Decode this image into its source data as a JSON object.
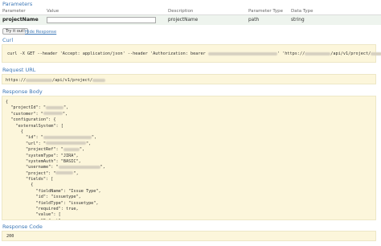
{
  "parameters": {
    "title": "Parameters",
    "headers": [
      "Parameter",
      "Value",
      "Description",
      "Parameter Type",
      "Data Type"
    ],
    "row": {
      "name": "projectName",
      "value": "",
      "description": "projectName",
      "param_type": "path",
      "data_type": "string"
    }
  },
  "actions": {
    "try_it": "Try it out!",
    "hide_response": "Hide Response"
  },
  "curl": {
    "title": "Curl",
    "part1": "curl -X GET --header 'Accept: application/json' --header 'Authorization: bearer ",
    "part2": "' 'https://",
    "part3": "/api/v1/project/",
    "part4": "'"
  },
  "request_url": {
    "title": "Request URL",
    "part1": "https://",
    "part2": "/api/v1/project/"
  },
  "response_body": {
    "title": "Response Body",
    "lines": [
      {
        "pre": "{",
        "post": ""
      },
      {
        "pre": "  \"projectId\": \"",
        "post": "\","
      },
      {
        "pre": "  \"customer\": \"",
        "post": "\","
      },
      {
        "pre": "  \"configuration\": {",
        "post": ""
      },
      {
        "pre": "    \"externalSystem\": [",
        "post": ""
      },
      {
        "pre": "      {",
        "post": ""
      },
      {
        "pre": "        \"id\": \"",
        "post": "\","
      },
      {
        "pre": "        \"url\": \"",
        "post": "\","
      },
      {
        "pre": "        \"projectRef\": \"",
        "post": "\","
      },
      {
        "pre": "        \"systemType\": \"JIRA\",",
        "post": ""
      },
      {
        "pre": "        \"systemAuth\": \"BASIC\",",
        "post": ""
      },
      {
        "pre": "        \"username\": \"",
        "post": "\","
      },
      {
        "pre": "        \"project\": \"",
        "post": "\","
      },
      {
        "pre": "        \"fields\": [",
        "post": ""
      },
      {
        "pre": "          {",
        "post": ""
      },
      {
        "pre": "            \"fieldName\": \"Issue Type\",",
        "post": ""
      },
      {
        "pre": "            \"id\": \"issuetype\",",
        "post": ""
      },
      {
        "pre": "            \"fieldType\": \"issuetype\",",
        "post": ""
      },
      {
        "pre": "            \"required\": true,",
        "post": ""
      },
      {
        "pre": "            \"value\": [",
        "post": ""
      },
      {
        "pre": "              \"Defect\"",
        "post": ""
      }
    ]
  },
  "response_code": {
    "title": "Response Code",
    "value": "200"
  }
}
